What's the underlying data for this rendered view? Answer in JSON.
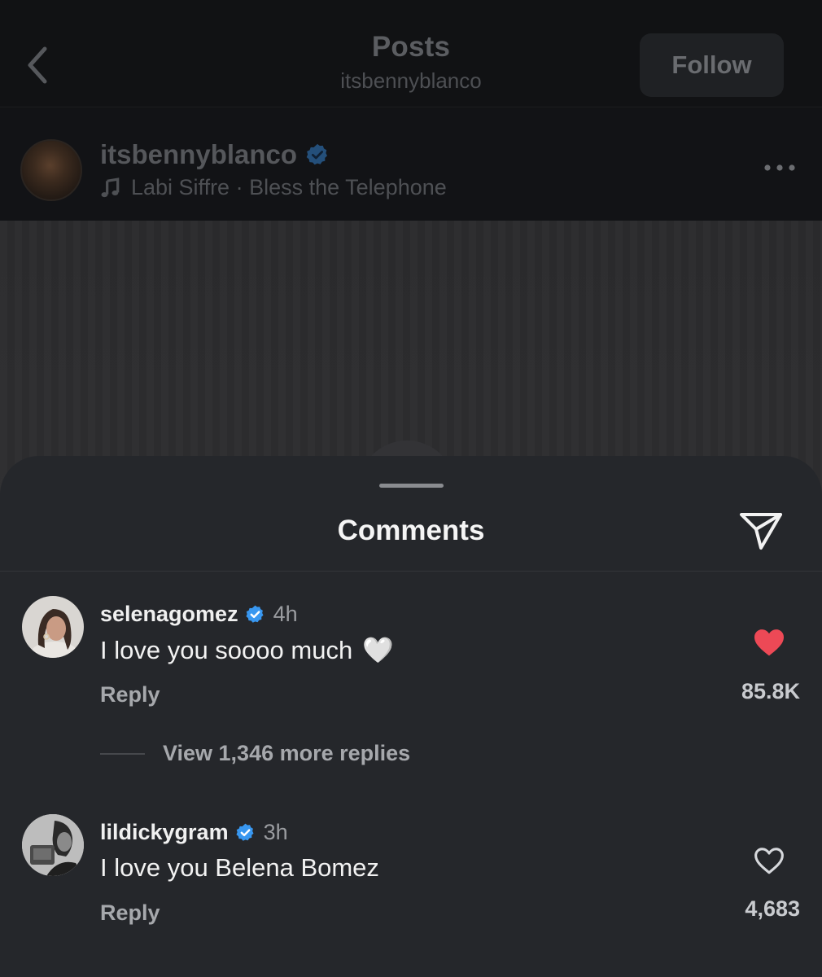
{
  "nav": {
    "title": "Posts",
    "subtitle": "itsbennyblanco",
    "follow_label": "Follow"
  },
  "post": {
    "username": "itsbennyblanco",
    "music": "Labi Siffre · Bless the Telephone"
  },
  "comments_sheet": {
    "title": "Comments",
    "comments": [
      {
        "username": "selenagomez",
        "time": "4h",
        "text": "I love you soooo much",
        "emoji": "🤍",
        "reply_label": "Reply",
        "like_count": "85.8K",
        "liked": true,
        "view_replies": "View 1,346 more replies"
      },
      {
        "username": "lildickygram",
        "time": "3h",
        "text": "I love you Belena Bomez",
        "reply_label": "Reply",
        "like_count": "4,683",
        "liked": false
      }
    ]
  },
  "colors": {
    "verified_blue": "#3897f0",
    "liked_red": "#ed4956",
    "sheet_bg": "#25272b"
  },
  "icons": {
    "back": "chevron-left-icon",
    "verified": "verified-badge-icon",
    "music": "music-note-icon",
    "more": "more-horizontal-icon",
    "share": "paper-plane-icon",
    "like_filled": "heart-filled-icon",
    "like_outline": "heart-outline-icon"
  }
}
